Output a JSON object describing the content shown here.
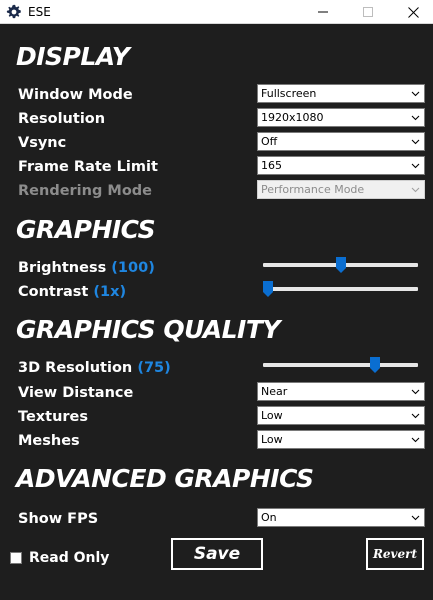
{
  "window": {
    "title": "ESE",
    "icon": "gear-icon"
  },
  "sections": {
    "display": "DISPLAY",
    "graphics": "GRAPHICS",
    "graphics_quality": "GRAPHICS QUALITY",
    "advanced_graphics": "ADVANCED GRAPHICS"
  },
  "display": {
    "window_mode": {
      "label": "Window Mode",
      "value": "Fullscreen"
    },
    "resolution": {
      "label": "Resolution",
      "value": "1920x1080"
    },
    "vsync": {
      "label": "Vsync",
      "value": "Off"
    },
    "frame_rate_limit": {
      "label": "Frame Rate Limit",
      "value": "165"
    },
    "rendering_mode": {
      "label": "Rendering Mode",
      "value": "Performance Mode",
      "disabled": true
    }
  },
  "graphics": {
    "brightness": {
      "label": "Brightness",
      "value_text": "(100)",
      "level": 0.5
    },
    "contrast": {
      "label": "Contrast",
      "value_text": "(1x)",
      "level": 0.0
    }
  },
  "graphics_quality": {
    "resolution_3d": {
      "label": "3D Resolution",
      "value_text": "(75)",
      "level": 0.74
    },
    "view_distance": {
      "label": "View Distance",
      "value": "Near"
    },
    "textures": {
      "label": "Textures",
      "value": "Low"
    },
    "meshes": {
      "label": "Meshes",
      "value": "Low"
    }
  },
  "advanced_graphics": {
    "show_fps": {
      "label": "Show FPS",
      "value": "On"
    }
  },
  "footer": {
    "read_only_label": "Read Only",
    "read_only_checked": false,
    "save_label": "Save",
    "revert_label": "Revert"
  },
  "colors": {
    "background": "#1e1e1e",
    "accent": "#1f86e0",
    "text": "#ffffff"
  }
}
